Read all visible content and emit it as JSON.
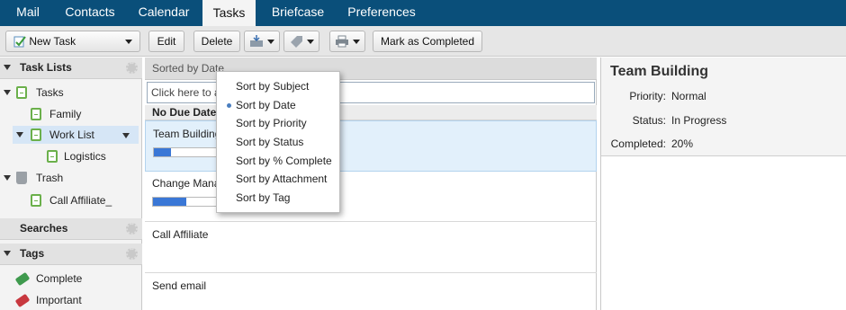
{
  "app_tabs": [
    "Mail",
    "Contacts",
    "Calendar",
    "Tasks",
    "Briefcase",
    "Preferences"
  ],
  "active_tab": "Tasks",
  "toolbar": {
    "new_task": "New Task",
    "edit": "Edit",
    "delete": "Delete",
    "mark_completed": "Mark as Completed"
  },
  "left": {
    "task_lists_header": "Task Lists",
    "tree": {
      "tasks": "Tasks",
      "family": "Family",
      "work_list": "Work List",
      "logistics": "Logistics",
      "trash": "Trash",
      "call_affiliate": "Call Affiliate_"
    },
    "searches_header": "Searches",
    "tags_header": "Tags",
    "tags": [
      {
        "label": "Complete",
        "color": "#3f9a4e"
      },
      {
        "label": "Important",
        "color": "#c8383f"
      }
    ]
  },
  "list": {
    "sort_label": "Sorted by Date",
    "quick_add_placeholder": "Click here to a",
    "group_label": "No Due Date",
    "tasks": [
      {
        "name": "Team Building",
        "progress": 0.2
      },
      {
        "name": "Change Management",
        "progress": 0.4
      },
      {
        "name": "Call Affiliate"
      },
      {
        "name": "Send email"
      }
    ]
  },
  "sort_menu": {
    "items": [
      "Sort by Subject",
      "Sort by Date",
      "Sort by Priority",
      "Sort by Status",
      "Sort by % Complete",
      "Sort by Attachment",
      "Sort by Tag"
    ],
    "selected": "Sort by Date"
  },
  "detail": {
    "title": "Team Building",
    "priority_label": "Priority:",
    "priority": "Normal",
    "status_label": "Status:",
    "status": "In Progress",
    "completed_label": "Completed:",
    "completed": "20%"
  },
  "colors": {
    "topbar": "#0a4f7a",
    "progress": "#3a77d6",
    "selection": "#e2f0fb"
  }
}
